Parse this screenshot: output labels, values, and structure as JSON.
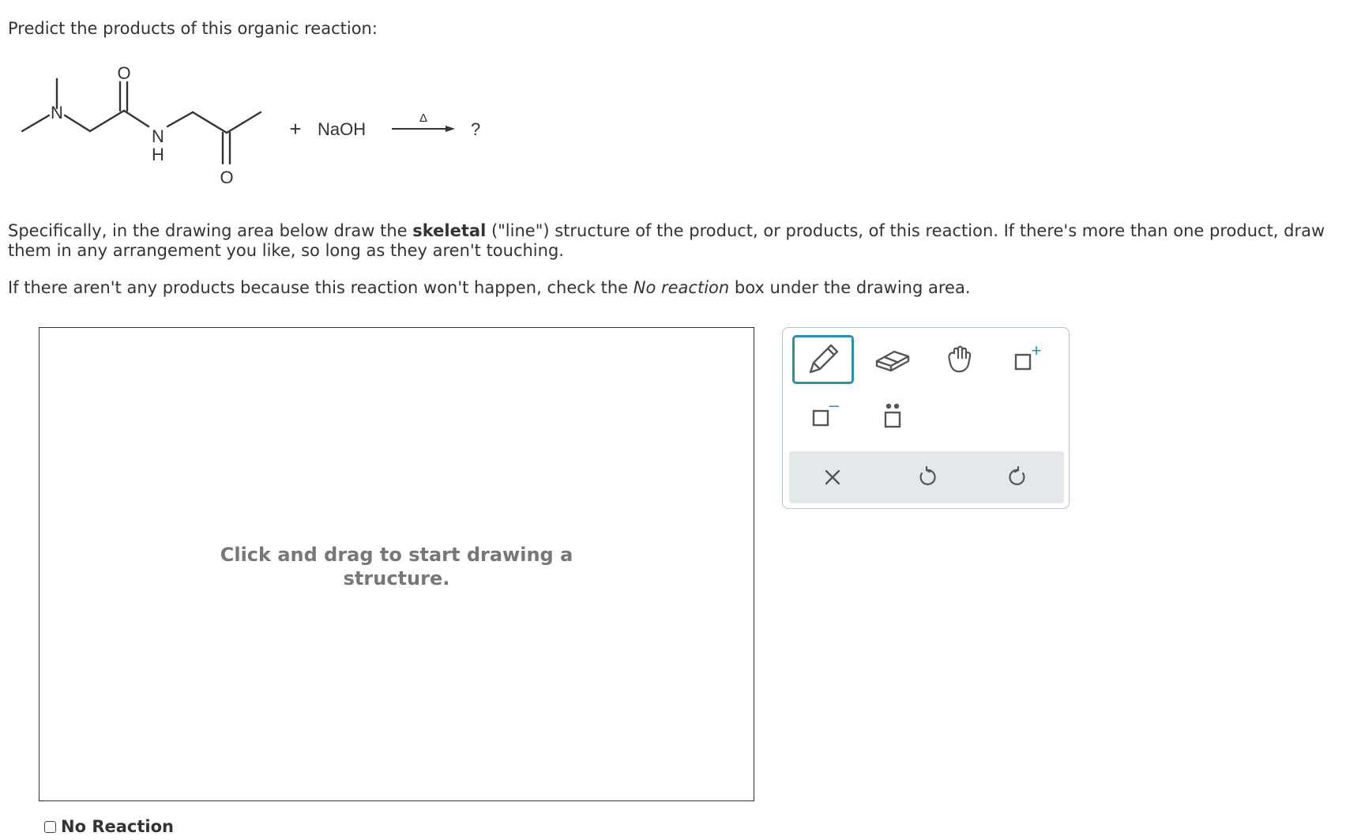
{
  "question": {
    "title": "Predict the products of this organic reaction:",
    "instruction_pre": "Specifically, in the drawing area below draw the ",
    "instruction_bold": "skeletal",
    "instruction_post": " (\"line\") structure of the product, or products, of this reaction. If there's more than one product, draw them in any arrangement you like, so long as they aren't touching.",
    "no_reaction_pre": "If there aren't any products because this reaction won't happen, check the ",
    "no_reaction_em": "No reaction",
    "no_reaction_post": " box under the drawing area."
  },
  "reaction": {
    "atom_N1": "N",
    "atom_O1": "O",
    "atom_N2": "N",
    "atom_H": "H",
    "atom_O2": "O",
    "plus": "+",
    "reagent": "NaOH",
    "condition": "Δ",
    "product": "?"
  },
  "canvas": {
    "hint_line1": "Click and drag to start drawing a",
    "hint_line2": "structure."
  },
  "no_reaction_checkbox": {
    "label": "No Reaction",
    "checked": false
  },
  "toolbar": {
    "tools": [
      "pencil-icon",
      "eraser-icon",
      "hand-icon",
      "add-charge-icon",
      "remove-charge-icon",
      "lone-pair-icon"
    ],
    "actions": [
      "clear-icon",
      "undo-icon",
      "redo-icon"
    ],
    "charge_plus": "+",
    "charge_minus": "–",
    "accent": "#2a8fb0",
    "action_bg": "#e3e8eb"
  }
}
